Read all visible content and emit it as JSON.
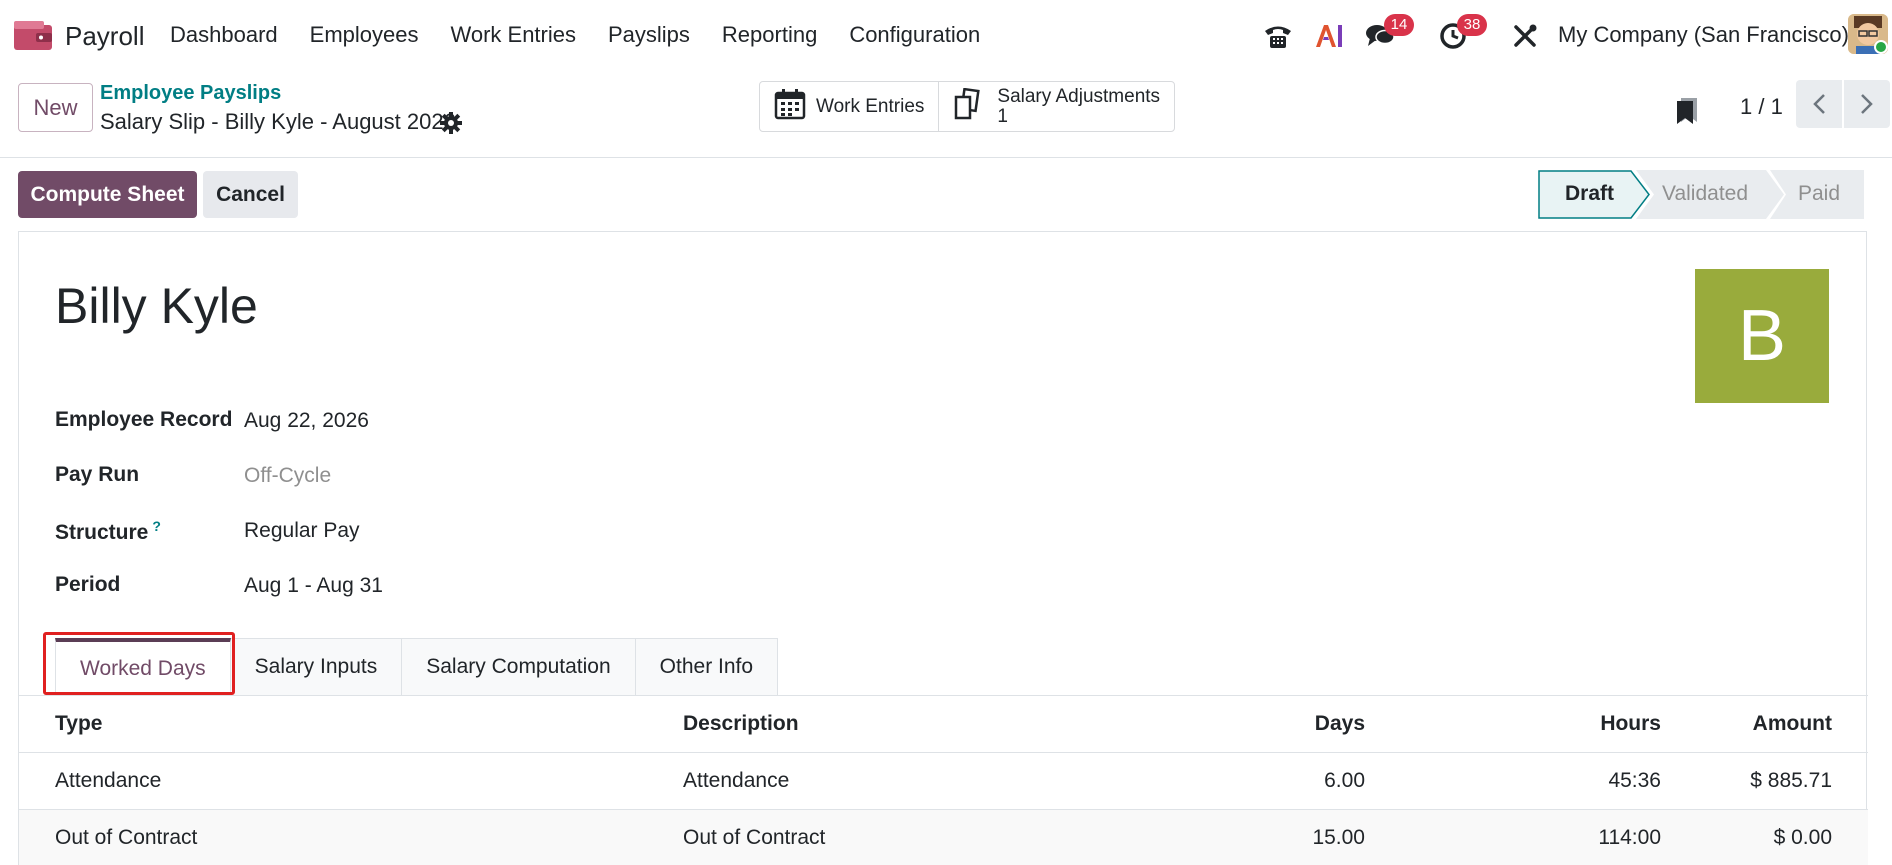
{
  "app": {
    "name": "Payroll",
    "brand_color": "#714b67"
  },
  "menu": [
    "Dashboard",
    "Employees",
    "Work Entries",
    "Payslips",
    "Reporting",
    "Configuration"
  ],
  "systray": {
    "messages_count": "14",
    "activities_count": "38",
    "company": "My Company (San Francisco)"
  },
  "control": {
    "new_label": "New",
    "breadcrumb_parent": "Employee Payslips",
    "breadcrumb_current": "Salary Slip - Billy Kyle - August 2026",
    "smart_buttons": {
      "work_entries": "Work Entries",
      "salary_adjustments": "Salary Adjustments",
      "salary_adjustments_count": "1"
    },
    "pager": "1 / 1"
  },
  "statusbar": {
    "compute_label": "Compute Sheet",
    "cancel_label": "Cancel",
    "stages": [
      "Draft",
      "Validated",
      "Paid"
    ],
    "current_stage": "Draft"
  },
  "form": {
    "employee_name": "Billy Kyle",
    "avatar_letter": "B",
    "avatar_color": "#99ab3c",
    "fields": {
      "employee_record_label": "Employee Record",
      "employee_record_value": "Aug 22, 2026",
      "pay_run_label": "Pay Run",
      "pay_run_value": "Off-Cycle",
      "structure_label": "Structure",
      "structure_help": "?",
      "structure_value": "Regular Pay",
      "period_label": "Period",
      "period_value": "Aug 1 - Aug 31"
    },
    "tabs": [
      "Worked Days",
      "Salary Inputs",
      "Salary Computation",
      "Other Info"
    ],
    "active_tab": "Worked Days"
  },
  "worked_days": {
    "columns": [
      "Type",
      "Description",
      "Days",
      "Hours",
      "Amount"
    ],
    "rows": [
      {
        "type": "Attendance",
        "description": "Attendance",
        "days": "6.00",
        "hours": "45:36",
        "amount": "$ 885.71"
      },
      {
        "type": "Out of Contract",
        "description": "Out of Contract",
        "days": "15.00",
        "hours": "114:00",
        "amount": "$ 0.00"
      }
    ]
  }
}
